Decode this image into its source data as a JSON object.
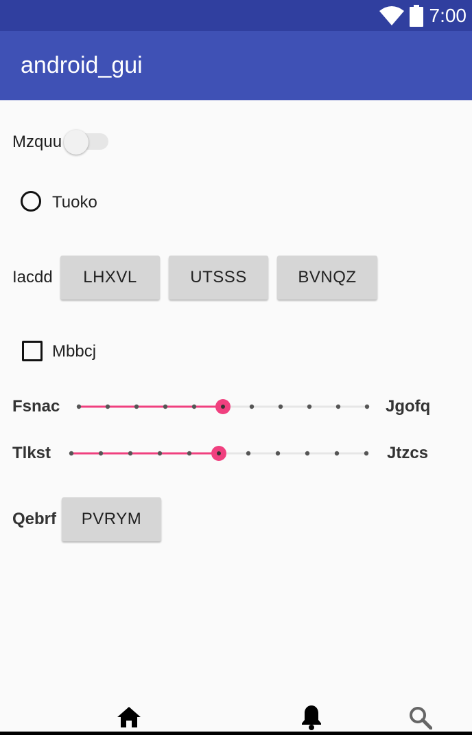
{
  "status_bar": {
    "time": "7:00",
    "icons": [
      "wifi-icon",
      "battery-icon"
    ],
    "color": "#303f9f"
  },
  "app_bar": {
    "title": "android_gui",
    "color": "#3f51b5"
  },
  "switch_row": {
    "label": "Mzquu",
    "checked": false
  },
  "radio_row": {
    "label": "Tuoko",
    "selected": false
  },
  "button_row": {
    "label": "Iacdd",
    "buttons": [
      "LHXVL",
      "UTSSS",
      "BVNQZ"
    ]
  },
  "checkbox_row": {
    "label": "Mbbcj",
    "checked": false
  },
  "slider1": {
    "start_label": "Fsnac",
    "end_label": "Jgofq",
    "steps": 10,
    "value": 5,
    "accent": "#f0407f"
  },
  "slider2": {
    "start_label": "Tlkst",
    "end_label": "Jtzcs",
    "steps": 10,
    "value": 5,
    "accent": "#f0407f"
  },
  "button_row2": {
    "label": "Qebrf",
    "button": "PVRYM"
  },
  "bottom_nav": {
    "icons": [
      "home-icon",
      "bell-icon",
      "search-icon"
    ]
  }
}
